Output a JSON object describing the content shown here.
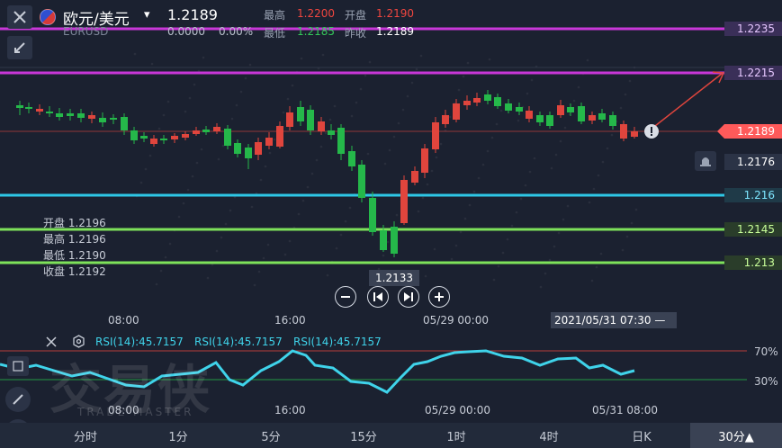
{
  "header": {
    "pair_name": "欧元/美元",
    "pair_code": "EURUSD",
    "last_price": "1.2189",
    "change_value": "0.0000",
    "change_percent": "0.00%",
    "high_label": "最高",
    "high_value": "1.2200",
    "low_label": "最低",
    "low_value": "1.2185",
    "open_label": "开盘",
    "open_value": "1.2190",
    "prev_close_label": "昨收",
    "prev_close_value": "1.2189"
  },
  "price_tags": [
    {
      "text": "1.2235",
      "color": "#c837d8"
    },
    {
      "text": "1.2215",
      "color": "#c837d8"
    },
    {
      "text": "1.2189",
      "color": "#ff5a5a"
    },
    {
      "text": "1.2176",
      "color": "#2b3346"
    },
    {
      "text": "1.216",
      "color": "#2ec7e6"
    },
    {
      "text": "1.2145",
      "color": "#7ee25a"
    },
    {
      "text": "1.213",
      "color": "#7ee25a"
    }
  ],
  "ohlc_box": {
    "open": "开盘 1.2196",
    "high": "最高 1.2196",
    "low": "最低 1.2190",
    "close": "收盘 1.2192"
  },
  "axis": {
    "time_labels_main": [
      "08:00",
      "16:00",
      "05/29 00:00"
    ],
    "time_labels_rsi": [
      "08:00",
      "16:00",
      "05/29 00:00",
      "05/31 08:00"
    ]
  },
  "crosshair": {
    "price": "1.2133",
    "time": "2021/05/31 07:30 —"
  },
  "rsi": {
    "labels": [
      "RSI(14):45.7157",
      "RSI(14):45.7157",
      "RSI(14):45.7157"
    ],
    "upper": "70%",
    "lower": "30%"
  },
  "watermark": {
    "main": "交易侠",
    "sub": "TRADE MASTER"
  },
  "tabs": [
    "分时",
    "1分",
    "5分",
    "15分",
    "1时",
    "4时",
    "日K",
    "30分▲"
  ],
  "colors": {
    "up": "#e0453d",
    "down": "#25b84a",
    "rsi_line": "#3fd3ea",
    "magenta": "#c837d8",
    "cyan": "#2ec7e6",
    "green": "#7ee25a"
  },
  "icons": [
    "close-icon",
    "collapse-icon",
    "bell-icon",
    "info-icon",
    "pencil-icon",
    "indicator-icon",
    "settings-icon",
    "zoom-out-icon",
    "zoom-in-icon",
    "prev-icon",
    "next-icon"
  ]
}
